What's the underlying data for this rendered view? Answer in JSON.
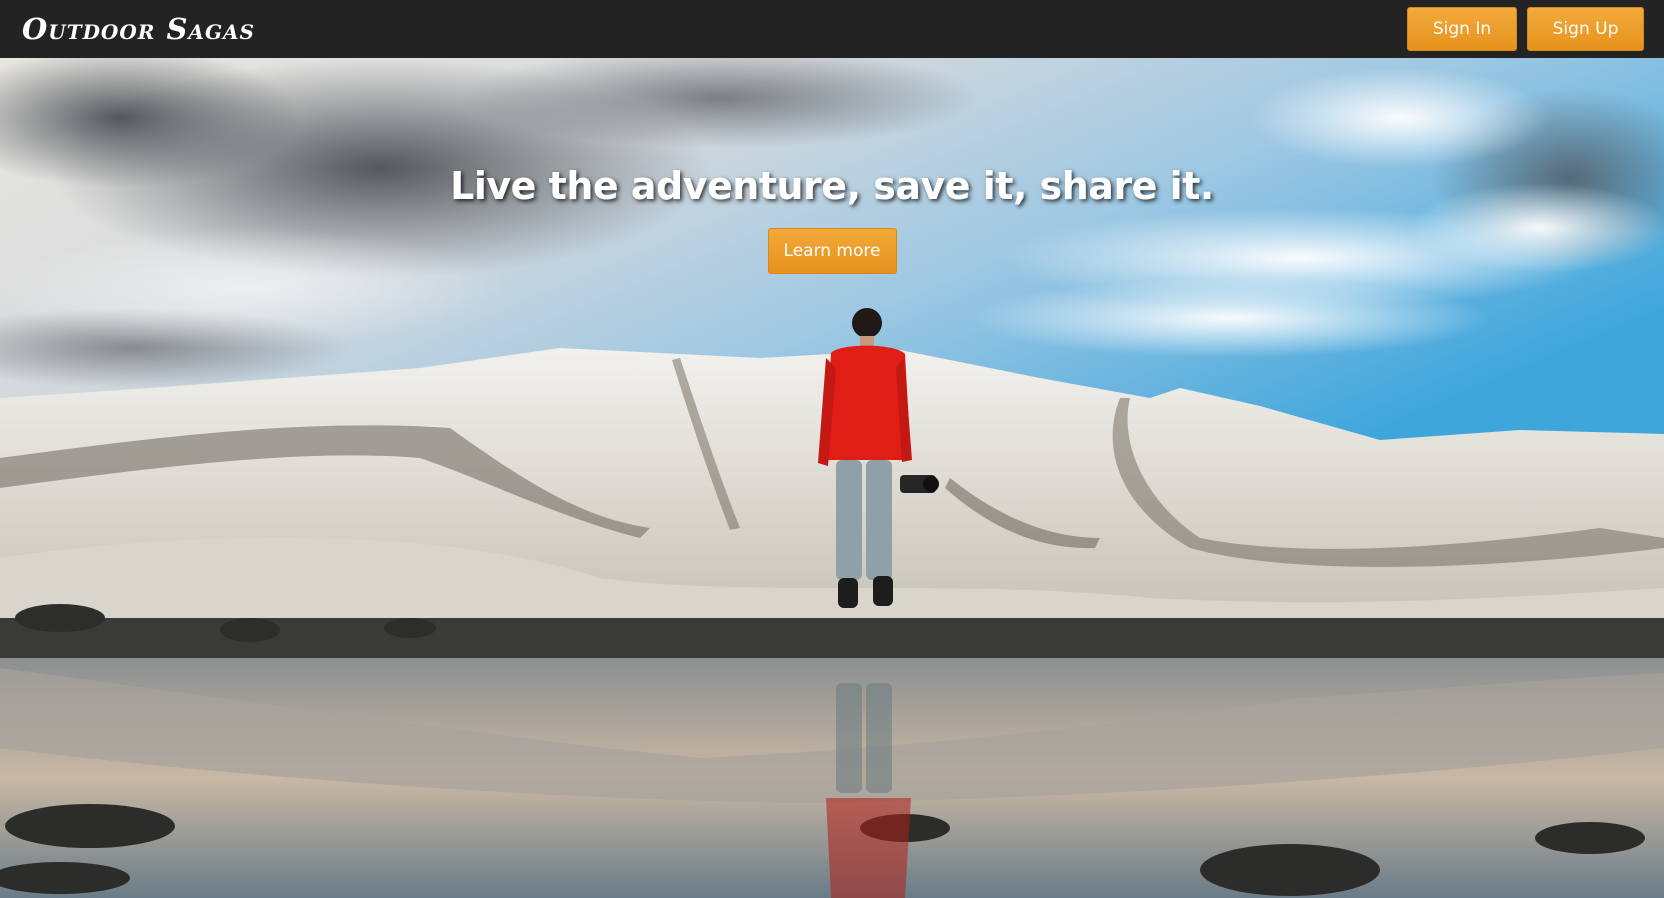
{
  "header": {
    "brand": "Outdoor Sagas",
    "signin_label": "Sign In",
    "signup_label": "Sign Up"
  },
  "hero": {
    "headline": "Live the adventure, save it, share it.",
    "cta_label": "Learn more",
    "image_description_icon": "hiker-glacier-photo"
  },
  "colors": {
    "navbar": "#232323",
    "accent": "#f0a030",
    "headline_text": "#ffffff"
  }
}
